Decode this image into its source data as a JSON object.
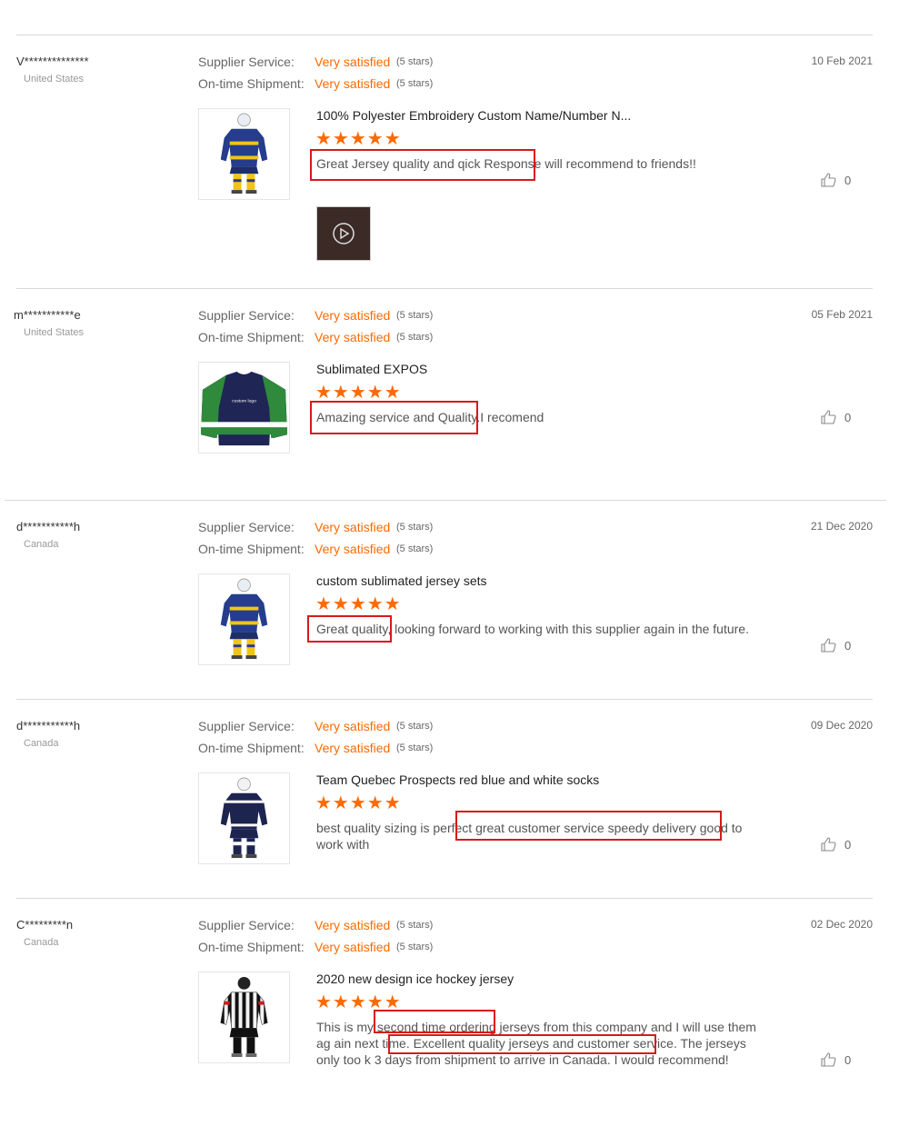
{
  "labels": {
    "supplier_service": "Supplier Service:",
    "ontime_shipment": "On-time Shipment:",
    "very_satisfied": "Very satisfied",
    "five_stars": "(5 stars)",
    "star_glyphs": "★★★★★"
  },
  "colors": {
    "accent": "#ff6a00",
    "highlight_box": "#d7191b"
  },
  "reviews": [
    {
      "user": "V**************",
      "country": "United States",
      "date": "10 Feb 2021",
      "product_title": "100% Polyester Embroidery Custom Name/Number N...",
      "text": "Great Jersey quality and qick Response  will recommend to friends!!",
      "likes": "0",
      "thumbnail": "blue-yellow-hockey-player-icon",
      "has_video": true
    },
    {
      "user": "m***********e",
      "country": "United States",
      "date": "05 Feb 2021",
      "product_title": "Sublimated EXPOS",
      "text": "Amazing service and Quality.I recomend",
      "likes": "0",
      "thumbnail": "navy-green-jersey-icon",
      "jersey_text": "custom logo"
    },
    {
      "user": "d***********h",
      "country": "Canada",
      "date": "21 Dec 2020",
      "product_title": "custom sublimated jersey sets",
      "text": "Great quality, looking forward to working with this supplier again in the future.",
      "likes": "0",
      "thumbnail": "blue-yellow-hockey-player-icon"
    },
    {
      "user": "d***********h",
      "country": "Canada",
      "date": "09 Dec 2020",
      "product_title": "Team Quebec Prospects red blue and white socks",
      "text": "best quality sizing is perfect great customer service speedy delivery good to work with",
      "likes": "0",
      "thumbnail": "navy-hockey-player-icon"
    },
    {
      "user": "C*********n",
      "country": "Canada",
      "date": "02 Dec 2020",
      "product_title": "2020 new design ice hockey jersey",
      "text": "This is my second time ordering jerseys from this company and I will use them ag ain next time. Excellent quality jerseys and customer service. The jerseys only too k 3 days from shipment to arrive in Canada. I would recommend!",
      "likes": "0",
      "thumbnail": "referee-striped-player-icon"
    }
  ]
}
